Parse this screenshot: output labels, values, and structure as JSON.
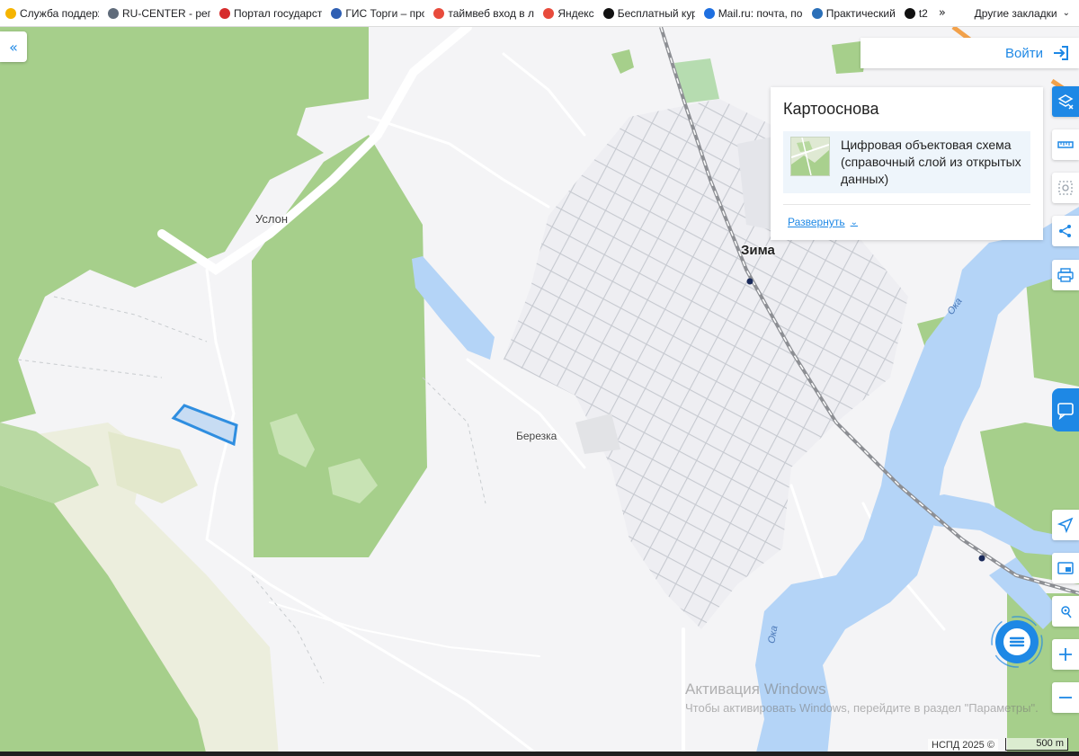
{
  "bookmarks": [
    {
      "label": "Служба поддерж",
      "color": "#f5b400",
      "icon": "chevron-icon"
    },
    {
      "label": "RU-CENTER - регі",
      "color": "#5f6b7a",
      "icon": "dots-icon"
    },
    {
      "label": "Портал государст",
      "color": "#d62c2c",
      "icon": "flag-icon"
    },
    {
      "label": "ГИС Торги – прод",
      "color": "#2f5fb3",
      "icon": "emblem-icon"
    },
    {
      "label": "таймвеб вход в лі",
      "color": "#e84b3c",
      "icon": "yandex-icon"
    },
    {
      "label": "Яндекс",
      "color": "#e84b3c",
      "icon": "yandex-icon"
    },
    {
      "label": "Бесплатный курс",
      "color": "#111111",
      "icon": "star-icon"
    },
    {
      "label": "Mail.ru: почта, пои",
      "color": "#1e6fe0",
      "icon": "at-icon"
    },
    {
      "label": "Практический",
      "color": "#2a6fb8",
      "icon": "globe-icon"
    },
    {
      "label": "t2",
      "color": "#111111",
      "icon": "t2-icon"
    }
  ],
  "bookmarks_more": "»",
  "bookmarks_other": "Другие закладки",
  "login_label": "Войти",
  "basemap_panel": {
    "title": "Картооснова",
    "layer_name": "Цифровая объектовая схема (справочный слой из открытых данных)",
    "expand_label": "Развернуть"
  },
  "map_labels": {
    "uslon": "Услон",
    "zima": "Зима",
    "berezka": "Березка",
    "oka_1": "Ока",
    "oka_2": "Ока"
  },
  "watermark": {
    "line1": "Активация Windows",
    "line2": "Чтобы активировать Windows, перейдите в раздел \"Параметры\"."
  },
  "attribution": "НСПД 2025 ©",
  "scale_label": "500 m",
  "colors": {
    "accent": "#1e88e5",
    "forest": "#a6cf8b",
    "water": "#b4d4f7",
    "field": "#eceedd",
    "road": "#ffffff",
    "parcel_fill": "#c7dcf3",
    "parcel_stroke": "#2f8ee0"
  }
}
